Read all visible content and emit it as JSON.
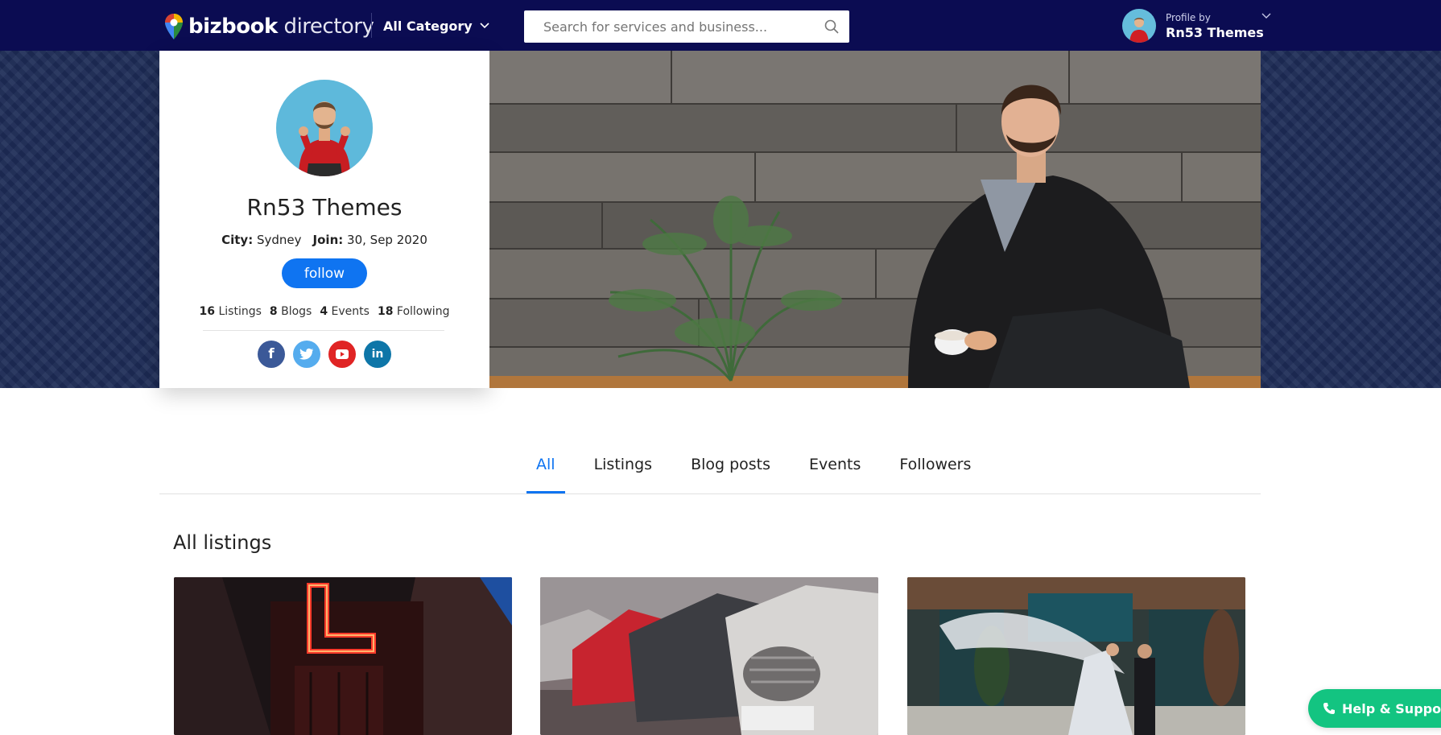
{
  "header": {
    "logo_bold": "bizbook",
    "logo_light": " directory",
    "category_label": "All Category",
    "search_placeholder": "Search for services and business...",
    "profile_by_label": "Profile by",
    "profile_name": "Rn53 Themes"
  },
  "profile": {
    "name": "Rn53 Themes",
    "city_label": "City:",
    "city": "Sydney",
    "join_label": "Join:",
    "join_date": "30, Sep 2020",
    "follow_label": "follow",
    "stats": [
      {
        "count": "16",
        "label": "Listings"
      },
      {
        "count": "8",
        "label": "Blogs"
      },
      {
        "count": "4",
        "label": "Events"
      },
      {
        "count": "18",
        "label": "Following"
      }
    ],
    "socials": [
      {
        "icon": "facebook-icon",
        "glyph": "f",
        "color": "#3b5998"
      },
      {
        "icon": "twitter-icon",
        "glyph": "t",
        "color": "#55acee"
      },
      {
        "icon": "youtube-icon",
        "glyph": "▶",
        "color": "#e02424"
      },
      {
        "icon": "linkedin-icon",
        "glyph": "in",
        "color": "#0e76a8"
      }
    ]
  },
  "tabs": [
    {
      "label": "All",
      "active": true
    },
    {
      "label": "Listings",
      "active": false
    },
    {
      "label": "Blog posts",
      "active": false
    },
    {
      "label": "Events",
      "active": false
    },
    {
      "label": "Followers",
      "active": false
    }
  ],
  "section_title": "All listings",
  "help_label": "Help & Support",
  "colors": {
    "header_bg": "#0b0c52",
    "accent": "#0f74f1",
    "help_bg": "#13c481"
  }
}
